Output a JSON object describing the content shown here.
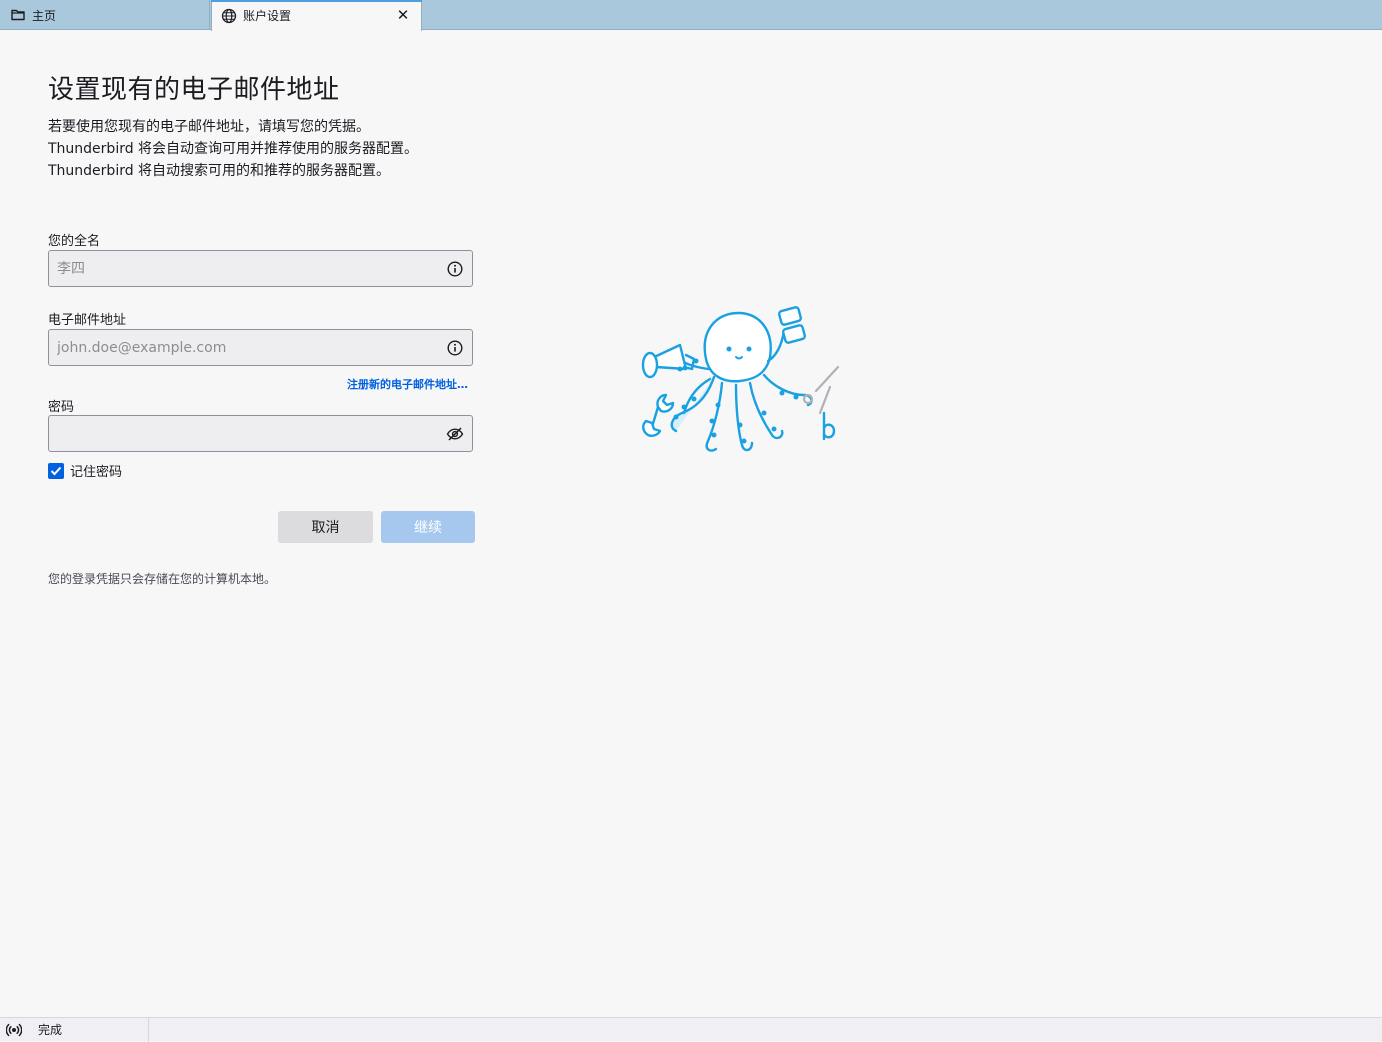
{
  "tabs": [
    {
      "label": "主页",
      "icon": "folder-icon"
    },
    {
      "label": "账户设置",
      "icon": "globe-icon",
      "active": true
    }
  ],
  "page": {
    "title": "设置现有的电子邮件地址",
    "description": [
      "若要使用您现有的电子邮件地址，请填写您的凭据。",
      "Thunderbird 将会自动查询可用并推荐使用的服务器配置。",
      "Thunderbird 将自动搜索可用的和推荐的服务器配置。"
    ]
  },
  "form": {
    "fullname": {
      "label": "您的全名",
      "placeholder": "李四",
      "value": ""
    },
    "email": {
      "label": "电子邮件地址",
      "placeholder": "john.doe@example.com",
      "value": ""
    },
    "new_email_link": "注册新的电子邮件地址…",
    "password": {
      "label": "密码",
      "value": ""
    },
    "remember_password": {
      "label": "记住密码",
      "checked": true
    },
    "cancel_label": "取消",
    "continue_label": "继续",
    "note": "您的登录凭据只会存储在您的计算机本地。"
  },
  "status": {
    "text": "完成",
    "icon": "activity-icon"
  },
  "colors": {
    "accent": "#0061e0",
    "tabbar": "#a9c8db",
    "illustration": "#1aa1e1"
  }
}
